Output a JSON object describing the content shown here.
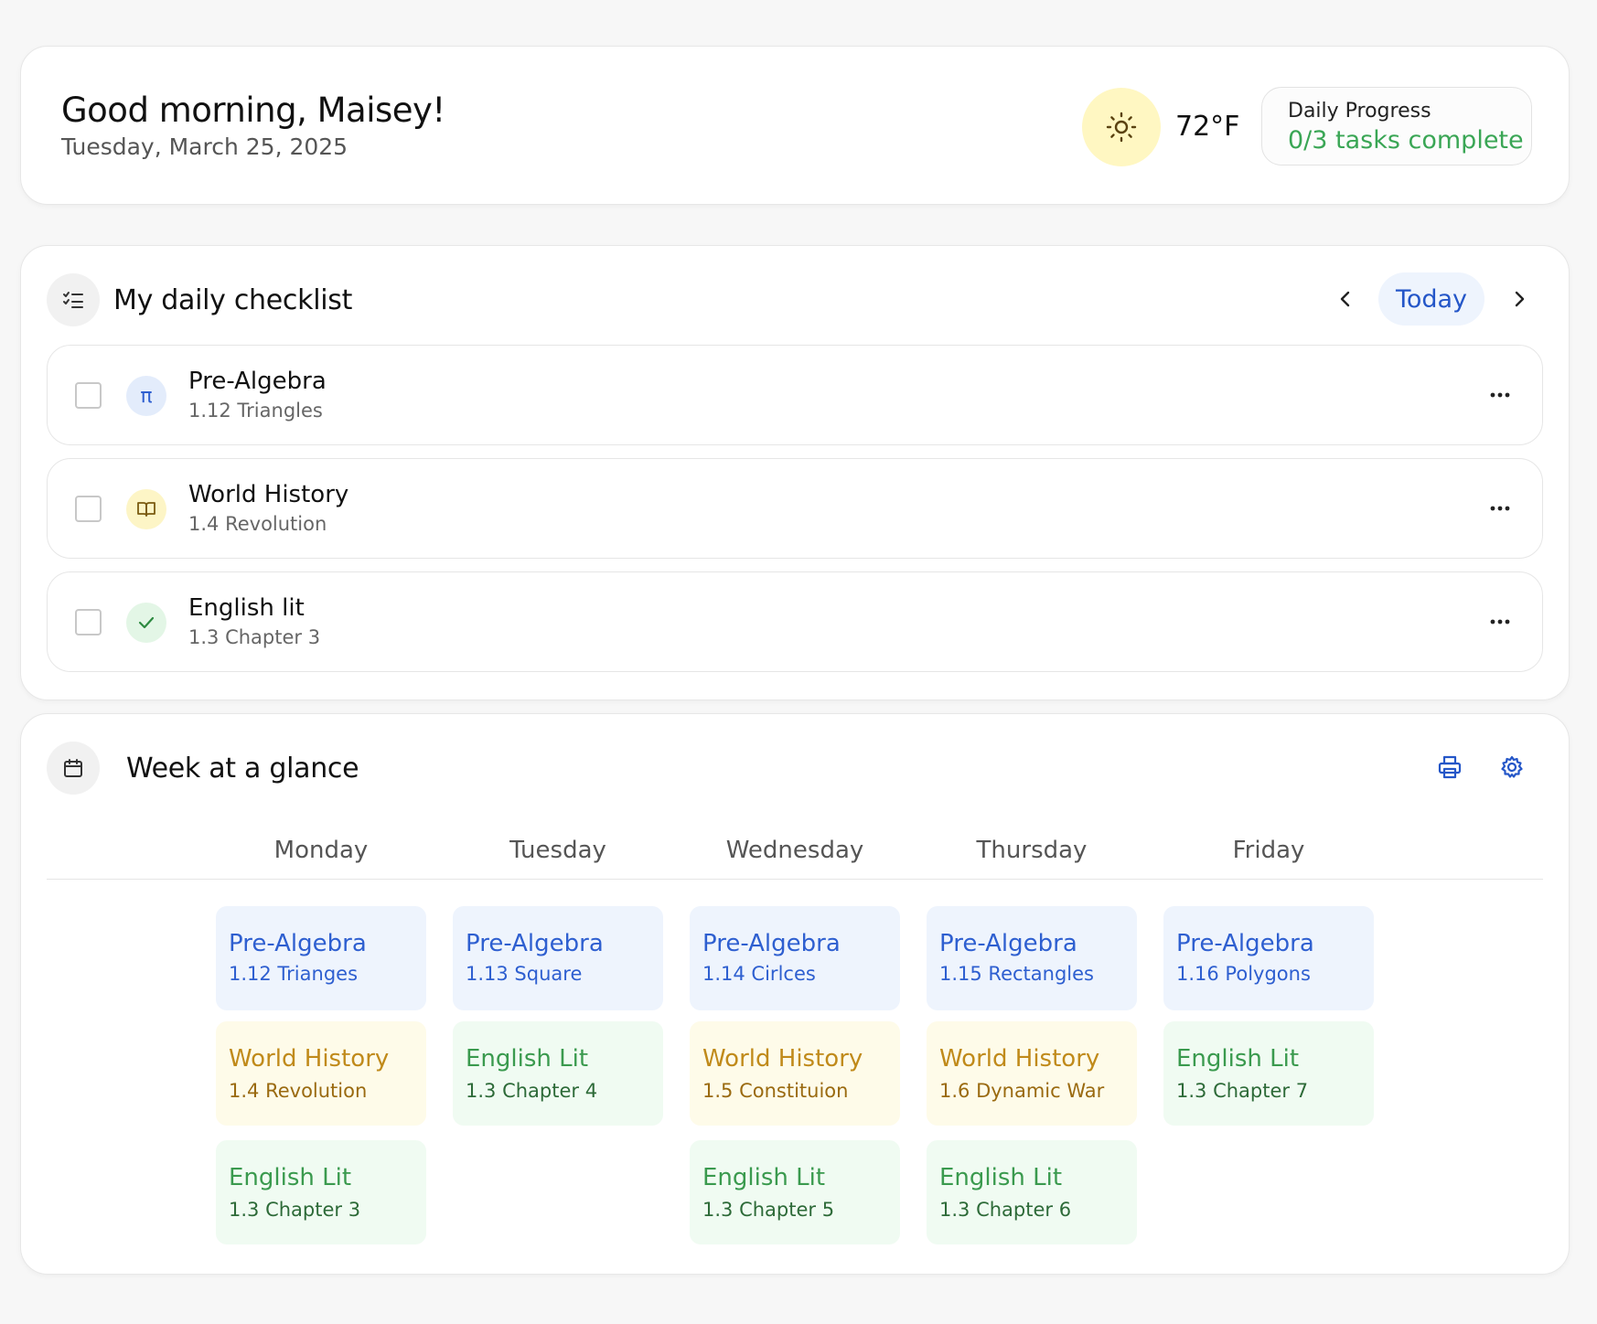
{
  "header": {
    "greeting": "Good morning, Maisey!",
    "date": "Tuesday, March 25, 2025",
    "weather_icon": "sun-icon",
    "temperature": "72°F",
    "progress_label": "Daily Progress",
    "progress_value": "0/3 tasks complete"
  },
  "checklist": {
    "title": "My daily checklist",
    "today_label": "Today",
    "tasks": [
      {
        "subject": "Pre-Algebra",
        "lesson": "1.12 Triangles",
        "icon": "π",
        "icon_name": "pi-icon",
        "icon_bg": "#e3ecfb",
        "icon_color": "#2e5fd0"
      },
      {
        "subject": "World History",
        "lesson": "1.4 Revolution",
        "icon": "book",
        "icon_name": "book-icon",
        "icon_bg": "#fdf5c6",
        "icon_color": "#8a6a10"
      },
      {
        "subject": "English lit",
        "lesson": "1.3 Chapter 3",
        "icon": "check",
        "icon_name": "check-icon",
        "icon_bg": "#e3f6e6",
        "icon_color": "#2d8a40"
      }
    ]
  },
  "week": {
    "title": "Week at a glance",
    "days": [
      "Monday",
      "Tuesday",
      "Wednesday",
      "Thursday",
      "Friday"
    ],
    "slots": [
      [
        {
          "type": "math",
          "subject": "Pre-Algebra",
          "lesson": "1.12 Trianges"
        },
        {
          "type": "hist",
          "subject": "World History",
          "lesson": "1.4 Revolution"
        },
        {
          "type": "eng",
          "subject": "English Lit",
          "lesson": "1.3 Chapter 3"
        }
      ],
      [
        {
          "type": "math",
          "subject": "Pre-Algebra",
          "lesson": "1.13 Square"
        },
        {
          "type": "eng",
          "subject": "English Lit",
          "lesson": "1.3 Chapter 4"
        }
      ],
      [
        {
          "type": "math",
          "subject": "Pre-Algebra",
          "lesson": "1.14 Cirlces"
        },
        {
          "type": "hist",
          "subject": "World History",
          "lesson": "1.5 Constituion"
        },
        {
          "type": "eng",
          "subject": "English Lit",
          "lesson": "1.3 Chapter 5"
        }
      ],
      [
        {
          "type": "math",
          "subject": "Pre-Algebra",
          "lesson": "1.15 Rectangles"
        },
        {
          "type": "hist",
          "subject": "World History",
          "lesson": "1.6 Dynamic War"
        },
        {
          "type": "eng",
          "subject": "English Lit",
          "lesson": "1.3 Chapter 6"
        }
      ],
      [
        {
          "type": "math",
          "subject": "Pre-Algebra",
          "lesson": "1.16 Polygons"
        },
        {
          "type": "eng",
          "subject": "English Lit",
          "lesson": "1.3 Chapter 7"
        }
      ]
    ]
  },
  "colors": {
    "accent_blue": "#2456c8",
    "progress_green": "#3aa655",
    "sun_bg": "#fff7c2"
  }
}
